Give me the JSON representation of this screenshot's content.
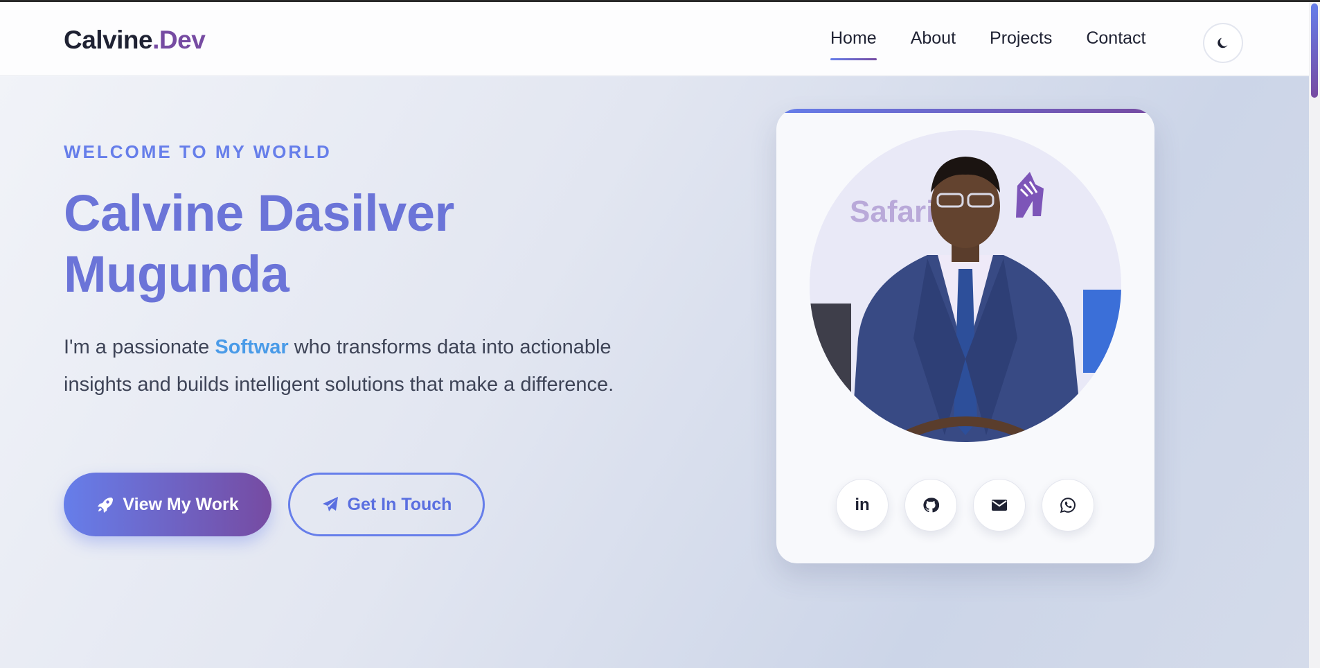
{
  "brand": {
    "name": "Calvine",
    "suffix": ".Dev"
  },
  "nav": {
    "items": [
      {
        "label": "Home",
        "active": true
      },
      {
        "label": "About",
        "active": false
      },
      {
        "label": "Projects",
        "active": false
      },
      {
        "label": "Contact",
        "active": false
      }
    ],
    "theme_toggle_icon": "moon-icon"
  },
  "hero": {
    "eyebrow": "WELCOME TO MY WORLD",
    "title_line1": "Calvine Dasilver",
    "title_line2": "Mugunda",
    "desc_prefix": "I'm a passionate ",
    "desc_highlight": "Softwar",
    "desc_suffix": " who transforms data into actionable insights and builds intelligent solutions that make a difference.",
    "primary_button": {
      "label": "View My Work",
      "icon": "rocket-icon"
    },
    "secondary_button": {
      "label": "Get In Touch",
      "icon": "paper-plane-icon"
    }
  },
  "profile_card": {
    "photo_banner_text": "Safari",
    "socials": [
      {
        "name": "linkedin-icon",
        "glyph": "in"
      },
      {
        "name": "github-icon"
      },
      {
        "name": "envelope-icon"
      },
      {
        "name": "whatsapp-icon"
      }
    ]
  },
  "colors": {
    "accent_start": "#667eea",
    "accent_end": "#764ba2",
    "highlight": "#4a9be8",
    "text_dark": "#1f2233"
  }
}
